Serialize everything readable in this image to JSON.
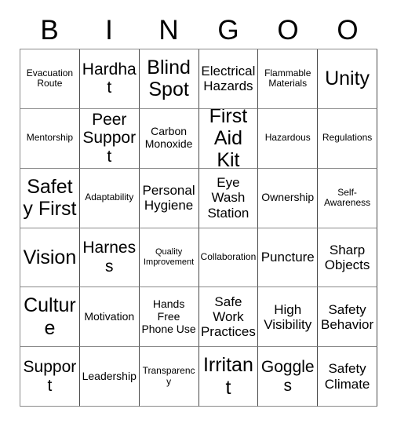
{
  "card": {
    "title_letters": [
      "B",
      "I",
      "N",
      "G",
      "O",
      "O"
    ],
    "columns": 6,
    "rows": 6,
    "colors": {
      "background": "#ffffff",
      "text": "#000000",
      "grid_line": "#8a8a8a",
      "grid_line_vertical": "#4a4a4a"
    },
    "cells": [
      {
        "text": "Evacuation Route",
        "size": "fs-xs"
      },
      {
        "text": "Hardhat",
        "size": "fs-lg"
      },
      {
        "text": "Blind Spot",
        "size": "fs-xl"
      },
      {
        "text": "Electrical Hazards",
        "size": "fs-md"
      },
      {
        "text": "Flammable Materials",
        "size": "fs-xs"
      },
      {
        "text": "Unity",
        "size": "fs-xl"
      },
      {
        "text": "Mentorship",
        "size": "fs-xs"
      },
      {
        "text": "Peer Support",
        "size": "fs-lg"
      },
      {
        "text": "Carbon Monoxide",
        "size": "fs-sm"
      },
      {
        "text": "First Aid Kit",
        "size": "fs-xl"
      },
      {
        "text": "Hazardous",
        "size": "fs-xs"
      },
      {
        "text": "Regulations",
        "size": "fs-xs"
      },
      {
        "text": "Safety First",
        "size": "fs-xl"
      },
      {
        "text": "Adaptability",
        "size": "fs-xs"
      },
      {
        "text": "Personal Hygiene",
        "size": "fs-md"
      },
      {
        "text": "Eye Wash Station",
        "size": "fs-md"
      },
      {
        "text": "Ownership",
        "size": "fs-sm"
      },
      {
        "text": "Self-Awareness",
        "size": "fs-xs"
      },
      {
        "text": "Vision",
        "size": "fs-xl"
      },
      {
        "text": "Harness",
        "size": "fs-lg"
      },
      {
        "text": "Quality Improvement",
        "size": "fs-xxs"
      },
      {
        "text": "Collaboration",
        "size": "fs-xs"
      },
      {
        "text": "Puncture",
        "size": "fs-md"
      },
      {
        "text": "Sharp Objects",
        "size": "fs-md"
      },
      {
        "text": "Culture",
        "size": "fs-xl"
      },
      {
        "text": "Motivation",
        "size": "fs-sm"
      },
      {
        "text": "Hands Free Phone Use",
        "size": "fs-sm"
      },
      {
        "text": "Safe Work Practices",
        "size": "fs-md"
      },
      {
        "text": "High Visibility",
        "size": "fs-md"
      },
      {
        "text": "Safety Behavior",
        "size": "fs-md"
      },
      {
        "text": "Support",
        "size": "fs-lg"
      },
      {
        "text": "Leadership",
        "size": "fs-sm"
      },
      {
        "text": "Transparency",
        "size": "fs-xs"
      },
      {
        "text": "Irritant",
        "size": "fs-xl"
      },
      {
        "text": "Goggles",
        "size": "fs-lg"
      },
      {
        "text": "Safety Climate",
        "size": "fs-md"
      }
    ]
  }
}
